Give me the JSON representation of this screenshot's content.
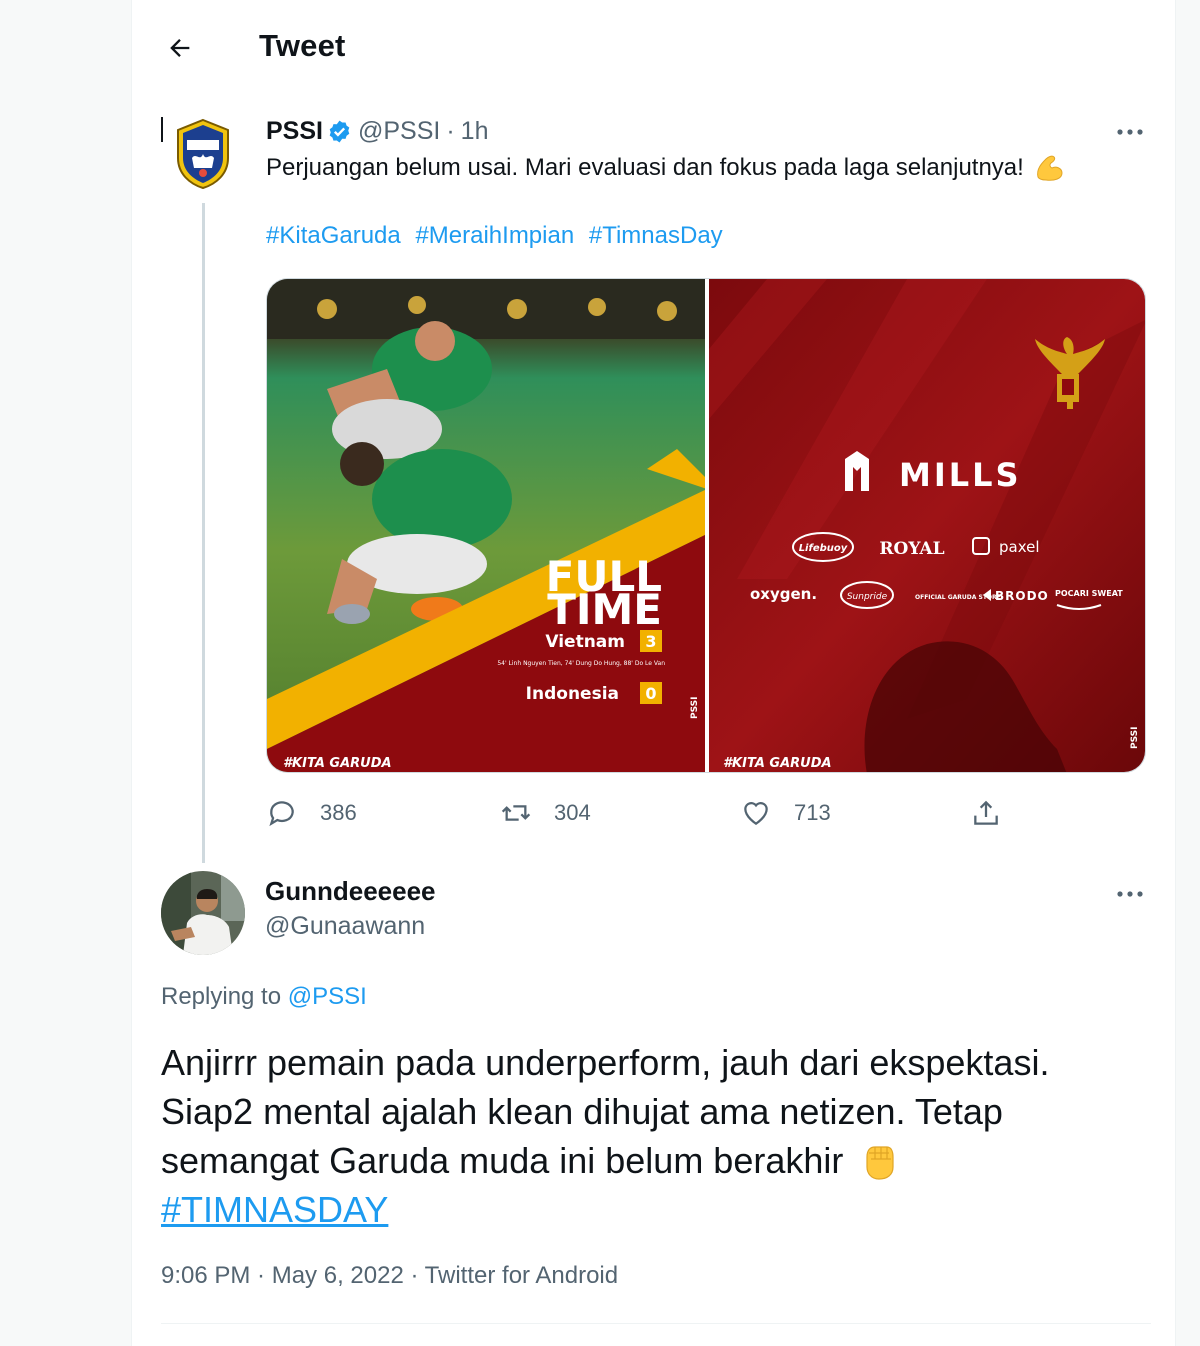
{
  "header": {
    "title": "Tweet"
  },
  "tweet": {
    "author_name": "PSSI",
    "author_handle": "@PSSI",
    "separator": "·",
    "time": "1h",
    "text": "Perjuangan belum usai. Mari evaluasi dan fokus pada laga selanjutnya!",
    "hashtags": [
      "#KitaGaruda",
      "#MeraihImpian",
      "#TimnasDay"
    ],
    "media": {
      "left": {
        "headline_1": "FULL",
        "headline_2": "TIME",
        "team_1": "Vietnam",
        "score_1": "3",
        "scorers": "54' Linh Nguyen Tien, 74' Dung Do Hung, 88' Do Le Van",
        "team_2": "Indonesia",
        "score_2": "0",
        "corner_tag": "#KITA GARUDA",
        "side_tag": "PSSI"
      },
      "right": {
        "sponsor_main": "MILLS",
        "sponsors_row_1": [
          "Lifebuoy",
          "ROYAL",
          "paxel"
        ],
        "sponsors_row_2": [
          "oxygen.",
          "Sunpride",
          "OFFICIAL GARUDA STORE",
          "BRODO",
          "POCARI SWEAT"
        ],
        "corner_tag": "#KITA GARUDA",
        "side_tag": "PSSI"
      }
    },
    "stats": {
      "replies": "386",
      "retweets": "304",
      "likes": "713"
    },
    "colors": {
      "accent": "#1d9bf0",
      "media_red": "#8e0a0e",
      "media_gold": "#f2b100"
    }
  },
  "reply": {
    "name": "Gunndeeeeee",
    "handle": "@Gunaawann",
    "replying_prefix": "Replying to",
    "replying_to": "@PSSI",
    "text": "Anjirrr pemain pada underperform, jauh dari ekspektasi. Siap2 mental ajalah klean dihujat ama netizen. Tetap semangat Garuda muda ini belum berakhir",
    "hashtag": "#TIMNASDAY",
    "meta": "9:06 PM · May 6, 2022 · Twitter for Android"
  }
}
